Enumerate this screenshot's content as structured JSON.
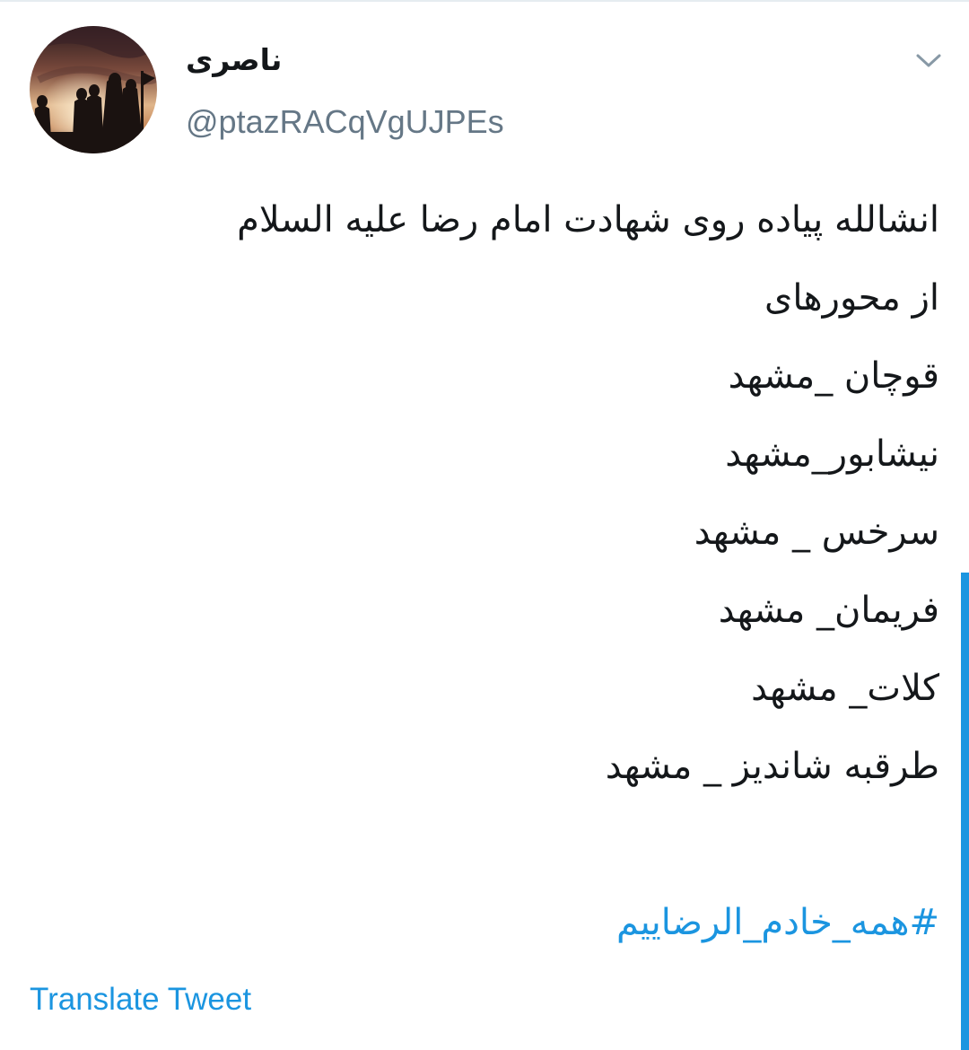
{
  "tweet": {
    "author": {
      "display_name": "ناصری",
      "handle": "@ptazRACqVgUJPEs",
      "avatar_icon": "avatar-silhouettes-sunset"
    },
    "menu_icon": "chevron-down-icon",
    "lines": [
      "انشالله پیاده روی شهادت امام رضا علیه السلام",
      "از محورهای",
      "قوچان _مشهد",
      "نیشابور_مشهد",
      "سرخس _ مشهد",
      "فریمان_ مشهد",
      "کلات_ مشهد",
      "طرقبه شاندیز _ مشهد"
    ],
    "hashtag": "#همه_خادم_الرضاییم",
    "translate_label": "Translate Tweet"
  },
  "colors": {
    "link": "#1b95e0",
    "text": "#14171a",
    "secondary": "#657786"
  }
}
